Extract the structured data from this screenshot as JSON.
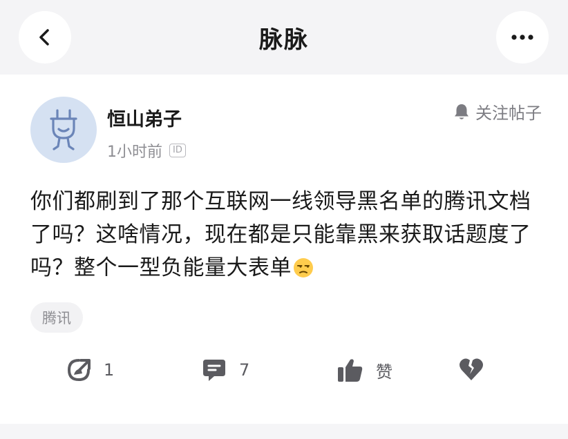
{
  "header": {
    "title": "脉脉",
    "back_icon": "chevron-left-icon",
    "more_icon": "more-horizontal-icon"
  },
  "post": {
    "author": {
      "name": "恒山弟子",
      "avatar_icon": "plug-avatar-icon",
      "avatar_color": "#d5e1f2"
    },
    "time": "1小时前",
    "id_badge": "ID",
    "follow_label": "关注帖子",
    "content": "你们都刷到了那个互联网一线领导黑名单的腾讯文档了吗？这啥情况，现在都是只能靠黑来获取话题度了吗？整个一型负能量大表单",
    "content_emoji": "unamused-face-emoji",
    "tag": "腾讯"
  },
  "actions": {
    "share_count": "1",
    "comment_count": "7",
    "like_label": "赞",
    "icon_color": "#5b5b60"
  }
}
